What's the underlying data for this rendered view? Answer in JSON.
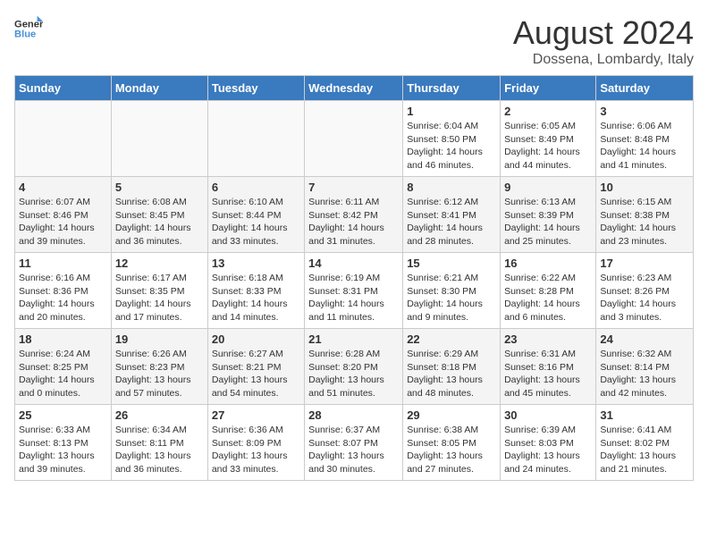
{
  "logo": {
    "line1": "General",
    "line2": "Blue"
  },
  "title": "August 2024",
  "location": "Dossena, Lombardy, Italy",
  "days_header": [
    "Sunday",
    "Monday",
    "Tuesday",
    "Wednesday",
    "Thursday",
    "Friday",
    "Saturday"
  ],
  "weeks": [
    [
      {
        "day": "",
        "info": ""
      },
      {
        "day": "",
        "info": ""
      },
      {
        "day": "",
        "info": ""
      },
      {
        "day": "",
        "info": ""
      },
      {
        "day": "1",
        "info": "Sunrise: 6:04 AM\nSunset: 8:50 PM\nDaylight: 14 hours\nand 46 minutes."
      },
      {
        "day": "2",
        "info": "Sunrise: 6:05 AM\nSunset: 8:49 PM\nDaylight: 14 hours\nand 44 minutes."
      },
      {
        "day": "3",
        "info": "Sunrise: 6:06 AM\nSunset: 8:48 PM\nDaylight: 14 hours\nand 41 minutes."
      }
    ],
    [
      {
        "day": "4",
        "info": "Sunrise: 6:07 AM\nSunset: 8:46 PM\nDaylight: 14 hours\nand 39 minutes."
      },
      {
        "day": "5",
        "info": "Sunrise: 6:08 AM\nSunset: 8:45 PM\nDaylight: 14 hours\nand 36 minutes."
      },
      {
        "day": "6",
        "info": "Sunrise: 6:10 AM\nSunset: 8:44 PM\nDaylight: 14 hours\nand 33 minutes."
      },
      {
        "day": "7",
        "info": "Sunrise: 6:11 AM\nSunset: 8:42 PM\nDaylight: 14 hours\nand 31 minutes."
      },
      {
        "day": "8",
        "info": "Sunrise: 6:12 AM\nSunset: 8:41 PM\nDaylight: 14 hours\nand 28 minutes."
      },
      {
        "day": "9",
        "info": "Sunrise: 6:13 AM\nSunset: 8:39 PM\nDaylight: 14 hours\nand 25 minutes."
      },
      {
        "day": "10",
        "info": "Sunrise: 6:15 AM\nSunset: 8:38 PM\nDaylight: 14 hours\nand 23 minutes."
      }
    ],
    [
      {
        "day": "11",
        "info": "Sunrise: 6:16 AM\nSunset: 8:36 PM\nDaylight: 14 hours\nand 20 minutes."
      },
      {
        "day": "12",
        "info": "Sunrise: 6:17 AM\nSunset: 8:35 PM\nDaylight: 14 hours\nand 17 minutes."
      },
      {
        "day": "13",
        "info": "Sunrise: 6:18 AM\nSunset: 8:33 PM\nDaylight: 14 hours\nand 14 minutes."
      },
      {
        "day": "14",
        "info": "Sunrise: 6:19 AM\nSunset: 8:31 PM\nDaylight: 14 hours\nand 11 minutes."
      },
      {
        "day": "15",
        "info": "Sunrise: 6:21 AM\nSunset: 8:30 PM\nDaylight: 14 hours\nand 9 minutes."
      },
      {
        "day": "16",
        "info": "Sunrise: 6:22 AM\nSunset: 8:28 PM\nDaylight: 14 hours\nand 6 minutes."
      },
      {
        "day": "17",
        "info": "Sunrise: 6:23 AM\nSunset: 8:26 PM\nDaylight: 14 hours\nand 3 minutes."
      }
    ],
    [
      {
        "day": "18",
        "info": "Sunrise: 6:24 AM\nSunset: 8:25 PM\nDaylight: 14 hours\nand 0 minutes."
      },
      {
        "day": "19",
        "info": "Sunrise: 6:26 AM\nSunset: 8:23 PM\nDaylight: 13 hours\nand 57 minutes."
      },
      {
        "day": "20",
        "info": "Sunrise: 6:27 AM\nSunset: 8:21 PM\nDaylight: 13 hours\nand 54 minutes."
      },
      {
        "day": "21",
        "info": "Sunrise: 6:28 AM\nSunset: 8:20 PM\nDaylight: 13 hours\nand 51 minutes."
      },
      {
        "day": "22",
        "info": "Sunrise: 6:29 AM\nSunset: 8:18 PM\nDaylight: 13 hours\nand 48 minutes."
      },
      {
        "day": "23",
        "info": "Sunrise: 6:31 AM\nSunset: 8:16 PM\nDaylight: 13 hours\nand 45 minutes."
      },
      {
        "day": "24",
        "info": "Sunrise: 6:32 AM\nSunset: 8:14 PM\nDaylight: 13 hours\nand 42 minutes."
      }
    ],
    [
      {
        "day": "25",
        "info": "Sunrise: 6:33 AM\nSunset: 8:13 PM\nDaylight: 13 hours\nand 39 minutes."
      },
      {
        "day": "26",
        "info": "Sunrise: 6:34 AM\nSunset: 8:11 PM\nDaylight: 13 hours\nand 36 minutes."
      },
      {
        "day": "27",
        "info": "Sunrise: 6:36 AM\nSunset: 8:09 PM\nDaylight: 13 hours\nand 33 minutes."
      },
      {
        "day": "28",
        "info": "Sunrise: 6:37 AM\nSunset: 8:07 PM\nDaylight: 13 hours\nand 30 minutes."
      },
      {
        "day": "29",
        "info": "Sunrise: 6:38 AM\nSunset: 8:05 PM\nDaylight: 13 hours\nand 27 minutes."
      },
      {
        "day": "30",
        "info": "Sunrise: 6:39 AM\nSunset: 8:03 PM\nDaylight: 13 hours\nand 24 minutes."
      },
      {
        "day": "31",
        "info": "Sunrise: 6:41 AM\nSunset: 8:02 PM\nDaylight: 13 hours\nand 21 minutes."
      }
    ]
  ]
}
